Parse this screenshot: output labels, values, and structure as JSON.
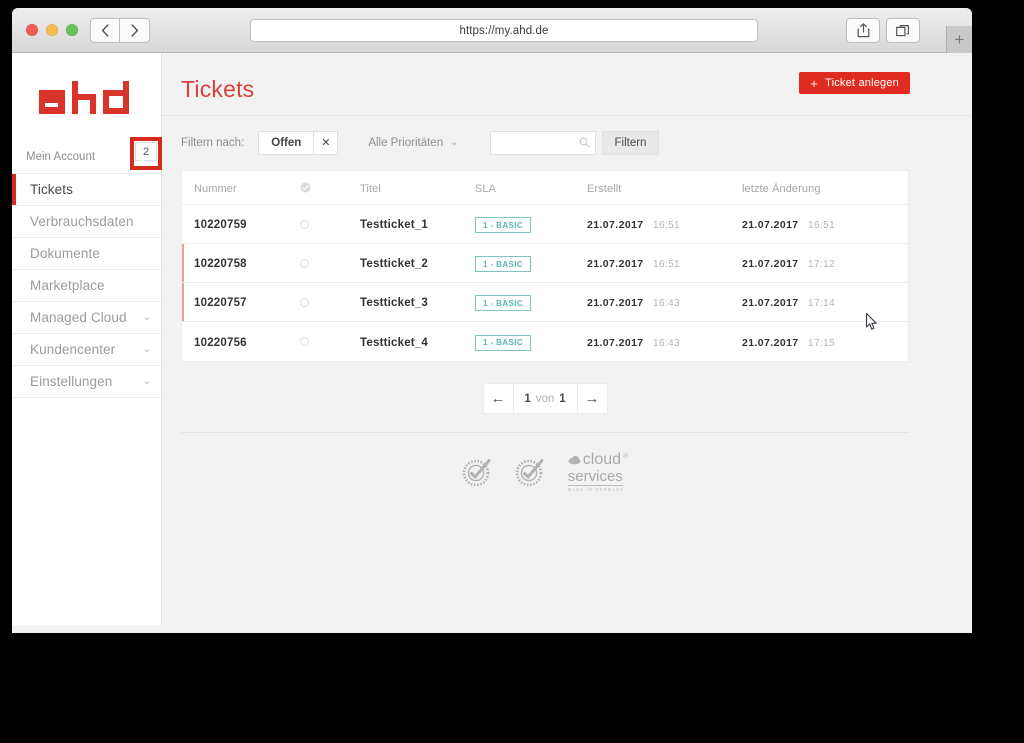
{
  "browser": {
    "url": "https://my.ahd.de",
    "back_label": "‹",
    "forward_label": "›",
    "new_tab_label": "+",
    "share_icon": "share-icon",
    "tabs_icon": "tabs-icon"
  },
  "sidebar": {
    "logo_text": "ahd",
    "account": {
      "label": "Mein Account",
      "chevron": "⌄",
      "badge_count": "2"
    },
    "items": [
      {
        "label": "Tickets",
        "active": true,
        "chevron": ""
      },
      {
        "label": "Verbrauchsdaten",
        "active": false,
        "chevron": ""
      },
      {
        "label": "Dokumente",
        "active": false,
        "chevron": ""
      },
      {
        "label": "Marketplace",
        "active": false,
        "chevron": ""
      },
      {
        "label": "Managed Cloud",
        "active": false,
        "chevron": "⌄"
      },
      {
        "label": "Kundencenter",
        "active": false,
        "chevron": "⌄"
      },
      {
        "label": "Einstellungen",
        "active": false,
        "chevron": "⌄"
      }
    ]
  },
  "header": {
    "title": "Tickets",
    "create_button": {
      "plus": "+",
      "label": "Ticket anlegen"
    }
  },
  "filters": {
    "label": "Filtern nach:",
    "active_chip": {
      "label": "Offen",
      "remove": "✕"
    },
    "priority": {
      "label": "Alle Prioritäten",
      "chevron": "⌄"
    },
    "search": {
      "value": "",
      "placeholder": ""
    },
    "submit_label": "Filtern"
  },
  "table": {
    "columns": [
      "Nummer",
      "",
      "Titel",
      "SLA",
      "Erstellt",
      "letzte Änderung"
    ],
    "status_header_icon": "check-circle-icon",
    "rows": [
      {
        "number": "10220759",
        "status": "open",
        "title": "Testticket_1",
        "sla": "1 - BASIC",
        "created_date": "21.07.2017",
        "created_time": "16:51",
        "changed_date": "21.07.2017",
        "changed_time": "16:51",
        "flagged": false
      },
      {
        "number": "10220758",
        "status": "open",
        "title": "Testticket_2",
        "sla": "1 - BASIC",
        "created_date": "21.07.2017",
        "created_time": "16:51",
        "changed_date": "21.07.2017",
        "changed_time": "17:12",
        "flagged": true
      },
      {
        "number": "10220757",
        "status": "open",
        "title": "Testticket_3",
        "sla": "1 - BASIC",
        "created_date": "21.07.2017",
        "created_time": "16:43",
        "changed_date": "21.07.2017",
        "changed_time": "17:14",
        "flagged": true
      },
      {
        "number": "10220756",
        "status": "open",
        "title": "Testticket_4",
        "sla": "1 - BASIC",
        "created_date": "21.07.2017",
        "created_time": "16:43",
        "changed_date": "21.07.2017",
        "changed_time": "17:15",
        "flagged": false
      }
    ]
  },
  "pagination": {
    "prev": "←",
    "next": "→",
    "current": "1",
    "of_label": "von",
    "total": "1"
  },
  "footer": {
    "logos": [
      {
        "name": "tuv-seal-1",
        "text": ""
      },
      {
        "name": "tuv-seal-2",
        "text": ""
      },
      {
        "name": "cloud-services",
        "line1": "cloud",
        "reg": "®",
        "line2": "services",
        "line3": "MADE IN GERMANY"
      }
    ]
  },
  "colors": {
    "brand_red": "#d52b1e",
    "button_red": "#e02b20",
    "title_red": "#d9413a",
    "sla_teal": "#5cb5ae",
    "page_bg": "#f2f2f2"
  }
}
